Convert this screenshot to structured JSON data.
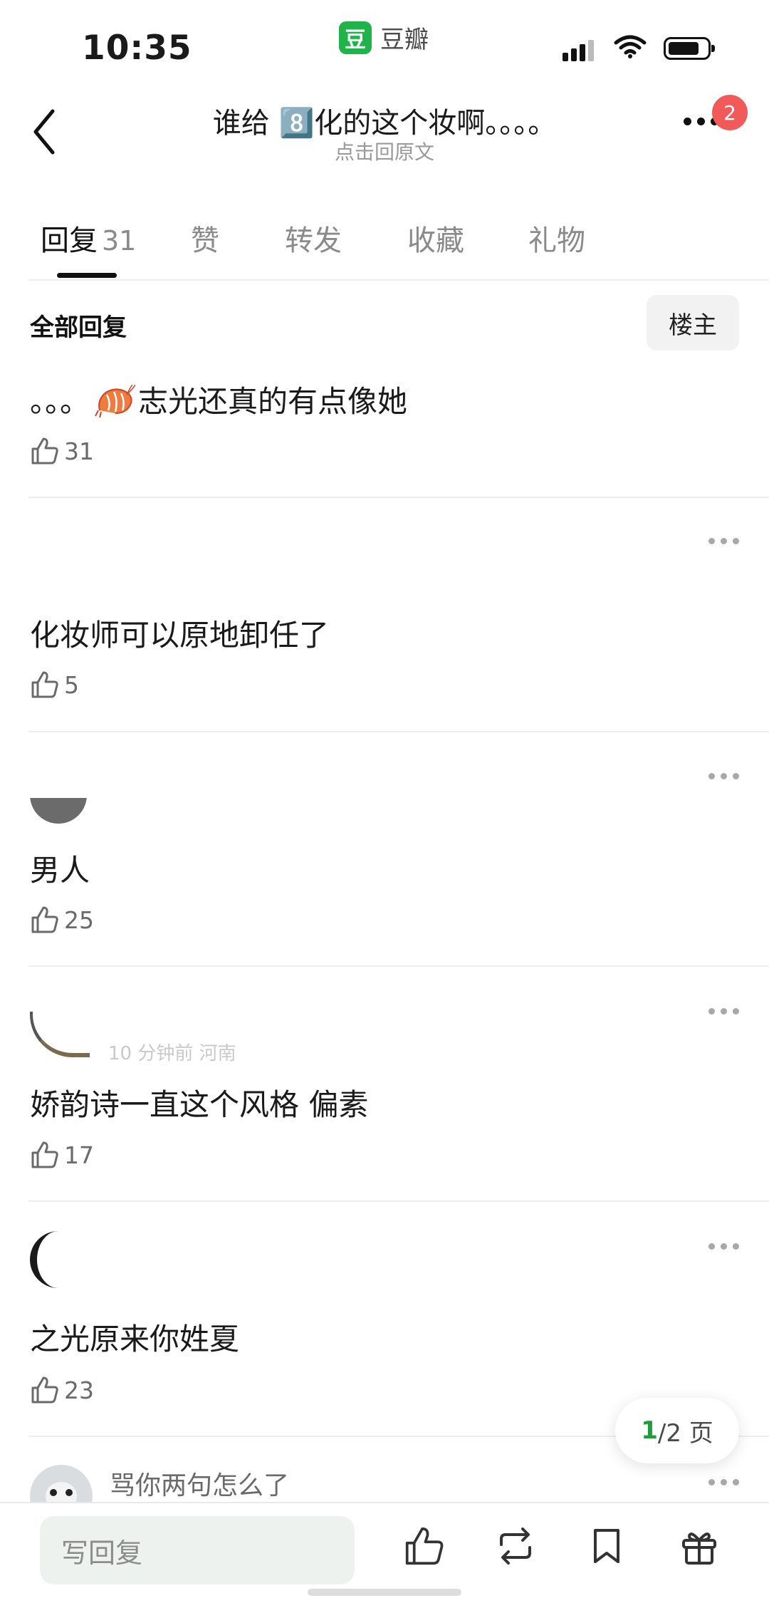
{
  "status_bar": {
    "time": "10:35",
    "app_name": "豆瓣",
    "app_logo_char": "豆",
    "brand_color": "#20b34a"
  },
  "header": {
    "title": "谁给 8️⃣化的这个妆啊。。。。",
    "subtitle": "点击回原文",
    "notification_count": "2"
  },
  "tabs": [
    {
      "label": "回复",
      "count": "31",
      "active": true
    },
    {
      "label": "赞"
    },
    {
      "label": "转发"
    },
    {
      "label": "收藏"
    },
    {
      "label": "礼物"
    }
  ],
  "section": {
    "title": "全部回复",
    "filter_button": "楼主"
  },
  "comments": [
    {
      "text_before": "。。。",
      "emoji": "shrimp-emoji",
      "text_after": "志光还真的有点像她",
      "likes": "31"
    },
    {
      "text": "化妆师可以原地卸任了",
      "likes": "5"
    },
    {
      "text": "男人",
      "likes": "25"
    },
    {
      "text": "娇韵诗一直这个风格 偏素",
      "likes": "17",
      "meta_partial": "10 分钟前 河南"
    },
    {
      "text": "之光原来你姓夏",
      "likes": "23"
    }
  ],
  "last_user": {
    "name": "骂你两句怎么了"
  },
  "pagination": {
    "current": "1",
    "total_suffix": "/2 页"
  },
  "bottom_bar": {
    "reply_placeholder": "写回复",
    "icons": [
      "like-icon",
      "repost-icon",
      "bookmark-icon",
      "gift-icon"
    ]
  },
  "colors": {
    "accent_green": "#1f9d3c",
    "badge_red": "#f25a5a"
  }
}
